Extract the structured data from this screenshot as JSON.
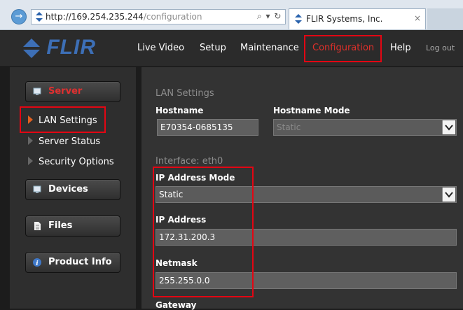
{
  "browser": {
    "url_host": "http://169.254.235.244",
    "url_path": "/configuration",
    "address_tools": "⌕ ▾ ↻",
    "tab_title": "FLIR Systems, Inc.",
    "tab_close": "×",
    "back_glyph": "→"
  },
  "header": {
    "logo_text": "FLIR",
    "brand_color": "#3d6fb6",
    "nav": {
      "live_video": "Live Video",
      "setup": "Setup",
      "maintenance": "Maintenance",
      "configuration": "Configuration",
      "help": "Help",
      "logout": "Log out"
    },
    "active_nav": "configuration"
  },
  "sidebar": {
    "server_label": "Server",
    "items": {
      "lan": "LAN Settings",
      "status": "Server Status",
      "security": "Security Options"
    },
    "devices_label": "Devices",
    "files_label": "Files",
    "product_info_label": "Product Info",
    "icons": [
      "server-icon",
      "devices-icon",
      "file-icon",
      "info-icon"
    ]
  },
  "main": {
    "lan_settings_title": "LAN Settings",
    "hostname_label": "Hostname",
    "hostname_value": "E70354-0685135",
    "hostname_mode_label": "Hostname Mode",
    "hostname_mode_value": "Static",
    "interface_title": "Interface: eth0",
    "ip_mode_label": "IP Address Mode",
    "ip_mode_value": "Static",
    "ip_label": "IP Address",
    "ip_value": "172.31.200.3",
    "netmask_label": "Netmask",
    "netmask_value": "255.255.0.0",
    "gateway_label": "Gateway"
  },
  "colors": {
    "highlight": "#e30613",
    "active_text": "#e0302a"
  }
}
